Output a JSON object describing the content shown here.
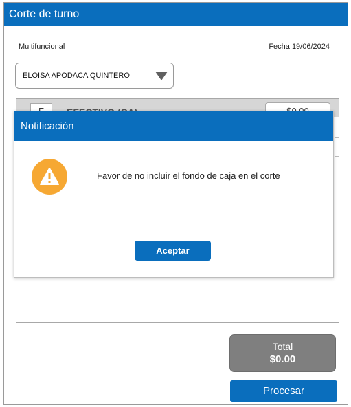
{
  "window": {
    "title": "Corte de turno"
  },
  "header": {
    "store_name": "Multifuncional",
    "date": "Fecha 19/06/2024"
  },
  "cashier_select": {
    "value": "ELOISA APODACA QUINTERO",
    "icon": "triangle-down-icon"
  },
  "table": {
    "rows": [
      {
        "key": "F",
        "label": "EFECTIVO (CA)",
        "amount": "$0.00"
      }
    ]
  },
  "dialog": {
    "title": "Notificación",
    "icon": "warning-icon",
    "message": "Favor de no incluir el fondo de caja en el corte",
    "accept_label": "Aceptar"
  },
  "footer": {
    "total_label": "Total",
    "total_value": "$0.00",
    "process_label": "Procesar"
  },
  "colors": {
    "primary": "#0a6ebd",
    "warning": "#f6a833",
    "total_box": "#7f7f7f"
  }
}
